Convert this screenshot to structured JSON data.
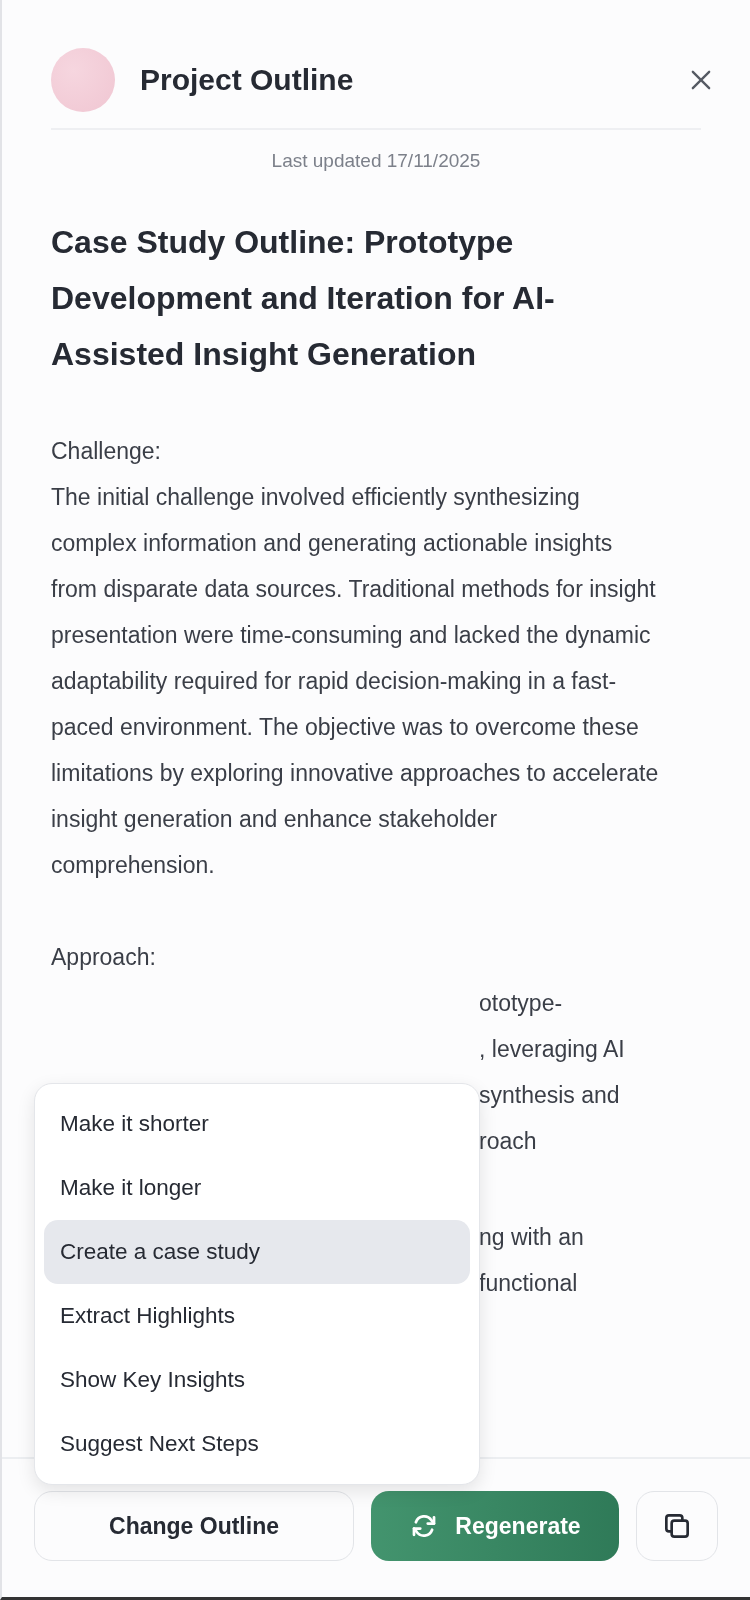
{
  "header": {
    "title": "Project Outline",
    "last_updated": "Last updated 17/11/2025"
  },
  "document": {
    "title": "Case Study Outline: Prototype Development and Iteration for AI-Assisted Insight Generation",
    "sections": [
      {
        "kind": "full",
        "heading": "Challenge:",
        "body": "The initial challenge involved efficiently synthesizing complex information and generating actionable insights from disparate data sources. Traditional methods for insight presentation were time-consuming and lacked the dynamic adaptability required for rapid decision-making in a fast-paced environment. The objective was to overcome these limitations by exploring innovative approaches to accelerate insight generation and enhance stakeholder comprehension."
      },
      {
        "kind": "partly_hidden",
        "heading": "Approach:",
        "paragraphs": [
          [
            "ototype-",
            ", leveraging AI",
            "synthesis and",
            "roach"
          ],
          [
            "ng with an",
            "functional"
          ]
        ]
      }
    ]
  },
  "menu": {
    "items": [
      {
        "label": "Make it shorter",
        "selected": false
      },
      {
        "label": "Make it longer",
        "selected": false
      },
      {
        "label": "Create a case study",
        "selected": true
      },
      {
        "label": "Extract Highlights",
        "selected": false
      },
      {
        "label": "Show Key Insights",
        "selected": false
      },
      {
        "label": "Suggest Next Steps",
        "selected": false
      }
    ]
  },
  "footer": {
    "buttons": [
      {
        "kind": "secondary",
        "label": "Change Outline"
      },
      {
        "kind": "primary",
        "label": "Regenerate"
      },
      {
        "kind": "copy"
      }
    ]
  }
}
